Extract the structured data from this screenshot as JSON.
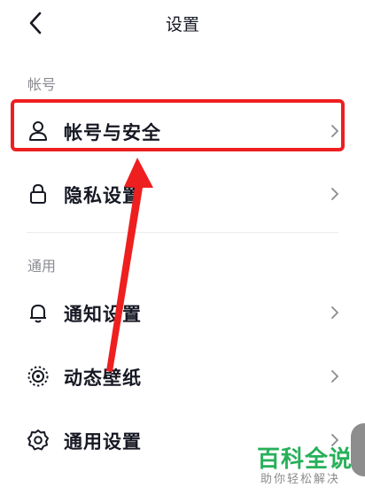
{
  "header": {
    "title": "设置",
    "back_icon": "chevron-left-icon"
  },
  "sections": [
    {
      "title": "帐号",
      "items": [
        {
          "label": "帐号与安全",
          "icon": "user-icon"
        },
        {
          "label": "隐私设置",
          "icon": "lock-icon"
        }
      ]
    },
    {
      "title": "通用",
      "items": [
        {
          "label": "通知设置",
          "icon": "bell-icon"
        },
        {
          "label": "动态壁纸",
          "icon": "wallpaper-icon"
        },
        {
          "label": "通用设置",
          "icon": "gear-icon"
        }
      ]
    }
  ],
  "annotation": {
    "color": "#ee1f1f"
  },
  "watermark": {
    "title": "百科全说",
    "subtitle": "助你轻松解决",
    "color": "#27b05a"
  }
}
